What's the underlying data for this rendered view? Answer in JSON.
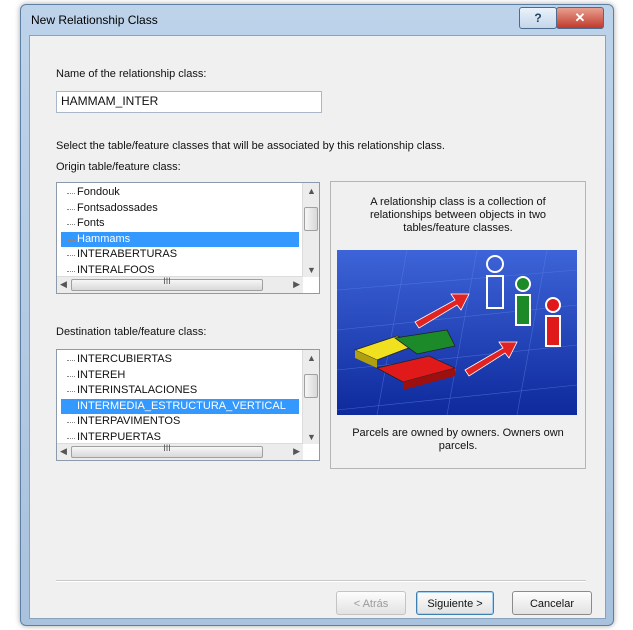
{
  "window": {
    "title": "New Relationship Class"
  },
  "titlebar": {
    "help_label": "?",
    "close_label": "✕"
  },
  "name_section": {
    "label": "Name of the relationship class:",
    "value": "HAMMAM_INTER"
  },
  "select_instruction": "Select the table/feature classes that will be associated by this relationship class.",
  "origin": {
    "label": "Origin table/feature class:",
    "items": [
      "Fondouk",
      "Fontsadossades",
      "Fonts",
      "Hammams",
      "INTERABERTURAS",
      "INTERALFOOS"
    ],
    "selected_index": 3
  },
  "destination": {
    "label": "Destination table/feature class:",
    "items": [
      "INTERCUBIERTAS",
      "INTEREH",
      "INTERINSTALACIONES",
      "INTERMEDIA_ESTRUCTURA_VERTICAL",
      "INTERPAVIMENTOS",
      "INTERPUERTAS"
    ],
    "selected_index": 3
  },
  "scroll_glyphs": {
    "up": "▲",
    "down": "▼",
    "left": "◀",
    "right": "▶",
    "grip": "III"
  },
  "info_panel": {
    "description": "A relationship class is a collection of relationships between objects in two tables/feature classes.",
    "caption": "Parcels are owned by owners. Owners own parcels."
  },
  "buttons": {
    "back": "< Atrás",
    "next": "Siguiente >",
    "cancel": "Cancelar"
  },
  "colors": {
    "selection": "#3399ff",
    "illustration_bg": "#1f3fb8"
  }
}
